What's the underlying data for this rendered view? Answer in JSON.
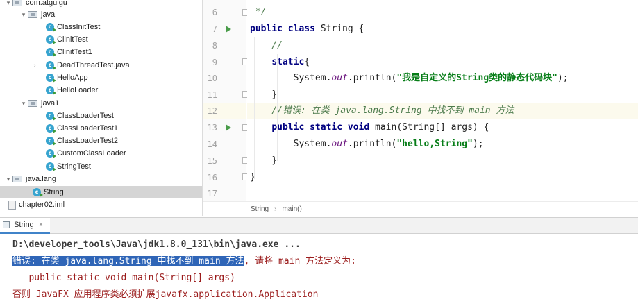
{
  "tree": {
    "items": [
      {
        "label": "com.atguigu",
        "kind": "folder",
        "expanded": true
      },
      {
        "label": "java",
        "kind": "folder",
        "expanded": true
      },
      {
        "label": "ClassInitTest",
        "kind": "class"
      },
      {
        "label": "ClinitTest",
        "kind": "class"
      },
      {
        "label": "ClinitTest1",
        "kind": "class"
      },
      {
        "label": "DeadThreadTest.java",
        "kind": "class",
        "collapsed": true
      },
      {
        "label": "HelloApp",
        "kind": "class"
      },
      {
        "label": "HelloLoader",
        "kind": "class"
      },
      {
        "label": "java1",
        "kind": "folder",
        "expanded": true
      },
      {
        "label": "ClassLoaderTest",
        "kind": "class"
      },
      {
        "label": "ClassLoaderTest1",
        "kind": "class"
      },
      {
        "label": "ClassLoaderTest2",
        "kind": "class"
      },
      {
        "label": "CustomClassLoader",
        "kind": "class"
      },
      {
        "label": "StringTest",
        "kind": "class"
      },
      {
        "label": "java.lang",
        "kind": "folder",
        "expanded": true
      },
      {
        "label": "String",
        "kind": "class",
        "selected": true
      },
      {
        "label": "chapter02.iml",
        "kind": "file"
      }
    ]
  },
  "editor": {
    "line_numbers": [
      "6",
      "7",
      "8",
      "9",
      "10",
      "11",
      "12",
      "13",
      "14",
      "15",
      "16",
      "17"
    ],
    "current_line": "12",
    "lines": {
      "l6": {
        "comment": " */"
      },
      "l7": {
        "kw": "public class ",
        "rest": "String {"
      },
      "l8": {
        "comment": "//"
      },
      "l9": {
        "kw": "static",
        "rest": "{"
      },
      "l10": {
        "pre": "System.",
        "field": "out",
        "mid": ".println(",
        "str": "\"我是自定义的String类的静态代码块\"",
        "post": ");"
      },
      "l11": {
        "text": "}"
      },
      "l12": {
        "comment": "//错误: 在类 java.lang.String 中找不到 main 方法"
      },
      "l13": {
        "kw": "public static void ",
        "rest": "main(String[] args) {"
      },
      "l14": {
        "pre": "System.",
        "field": "out",
        "mid": ".println(",
        "str": "\"hello,String\"",
        "post": ");"
      },
      "l15": {
        "text": "}"
      },
      "l16": {
        "text": "}"
      }
    }
  },
  "breadcrumb": {
    "items": [
      "String",
      "main()"
    ],
    "separator": "›"
  },
  "run": {
    "tab_label": "String",
    "close_glyph": "×",
    "console": {
      "command": "D:\\developer_tools\\Java\\jdk1.8.0_131\\bin\\java.exe ...",
      "error_selected": "错误: 在类 java.lang.String 中找不到 main 方法",
      "error_rest": ", 请将 main 方法定义为:",
      "signature": "   public static void main(String[] args)",
      "javafx": "否则 JavaFX 应用程序类必须扩展javafx.application.Application"
    }
  },
  "colors": {
    "keyword": "#000080",
    "comment": "#4b7a4b",
    "string": "#067d17",
    "field": "#660e7a",
    "console_error": "#9b1c1c",
    "selection": "#2f65b7",
    "run_icon": "#4a9c4a",
    "class_icon": "#37a4cf"
  },
  "icons": {
    "folder": "folder-icon",
    "class": "java-class-icon",
    "file": "module-file-icon",
    "run": "run-gutter-icon",
    "fold": "fold-marker-icon",
    "expand": "chevron-down-icon",
    "collapse": "chevron-right-icon"
  }
}
